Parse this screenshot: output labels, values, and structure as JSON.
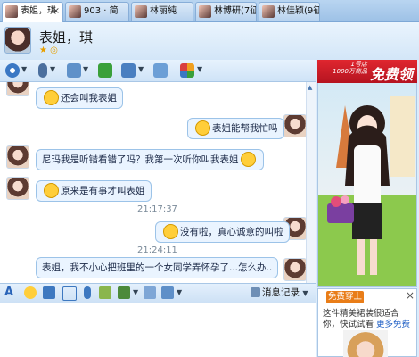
{
  "tabs": [
    {
      "label": "表姐，琪",
      "active": true
    },
    {
      "label": "903 · 简",
      "active": false
    },
    {
      "label": "林丽純",
      "active": false
    },
    {
      "label": "林博研(7征",
      "active": false
    },
    {
      "label": "林佳颖(9征",
      "active": false
    }
  ],
  "tab_close": "×",
  "contact": {
    "name": "表姐，琪",
    "status_icons": "★ ◎"
  },
  "messages": [
    {
      "side": "left",
      "text": "还会叫我表姐",
      "emoji": "cry"
    },
    {
      "side": "right",
      "text": "表姐能帮我忙吗",
      "emoji": "sweat"
    },
    {
      "side": "left",
      "text": "尼玛我是听错看错了吗？我第一次听你叫我表姐",
      "emoji": "cry"
    },
    {
      "side": "left",
      "text": "原来是有事才叫表姐",
      "emoji": "shock"
    },
    {
      "side": "time",
      "text": "21:17:37"
    },
    {
      "side": "right",
      "text": "没有啦，真心诚意的叫啦",
      "emoji": "smile"
    },
    {
      "side": "time",
      "text": "21:24:11"
    },
    {
      "side": "right",
      "text": "表姐，我不小心把班里的一个女同学弄怀孕了...怎么办..",
      "emoji": ""
    }
  ],
  "input_toolbar": {
    "message_record": "消息记录"
  },
  "ad_top": {
    "small_line1": "1号店",
    "small_line2": "1000万商品",
    "big": "免费领"
  },
  "ad_bottom": {
    "title": "免费穿上",
    "line1": "这件精美裙装很适合",
    "line2_prefix": "你，快试试看",
    "line2_link": "更多免费",
    "close": "×"
  },
  "colors": {
    "accent": "#6aa6e0",
    "bubble": "#eaf4ff",
    "ad_red": "#d21d27",
    "ad_orange": "#e97d18"
  }
}
